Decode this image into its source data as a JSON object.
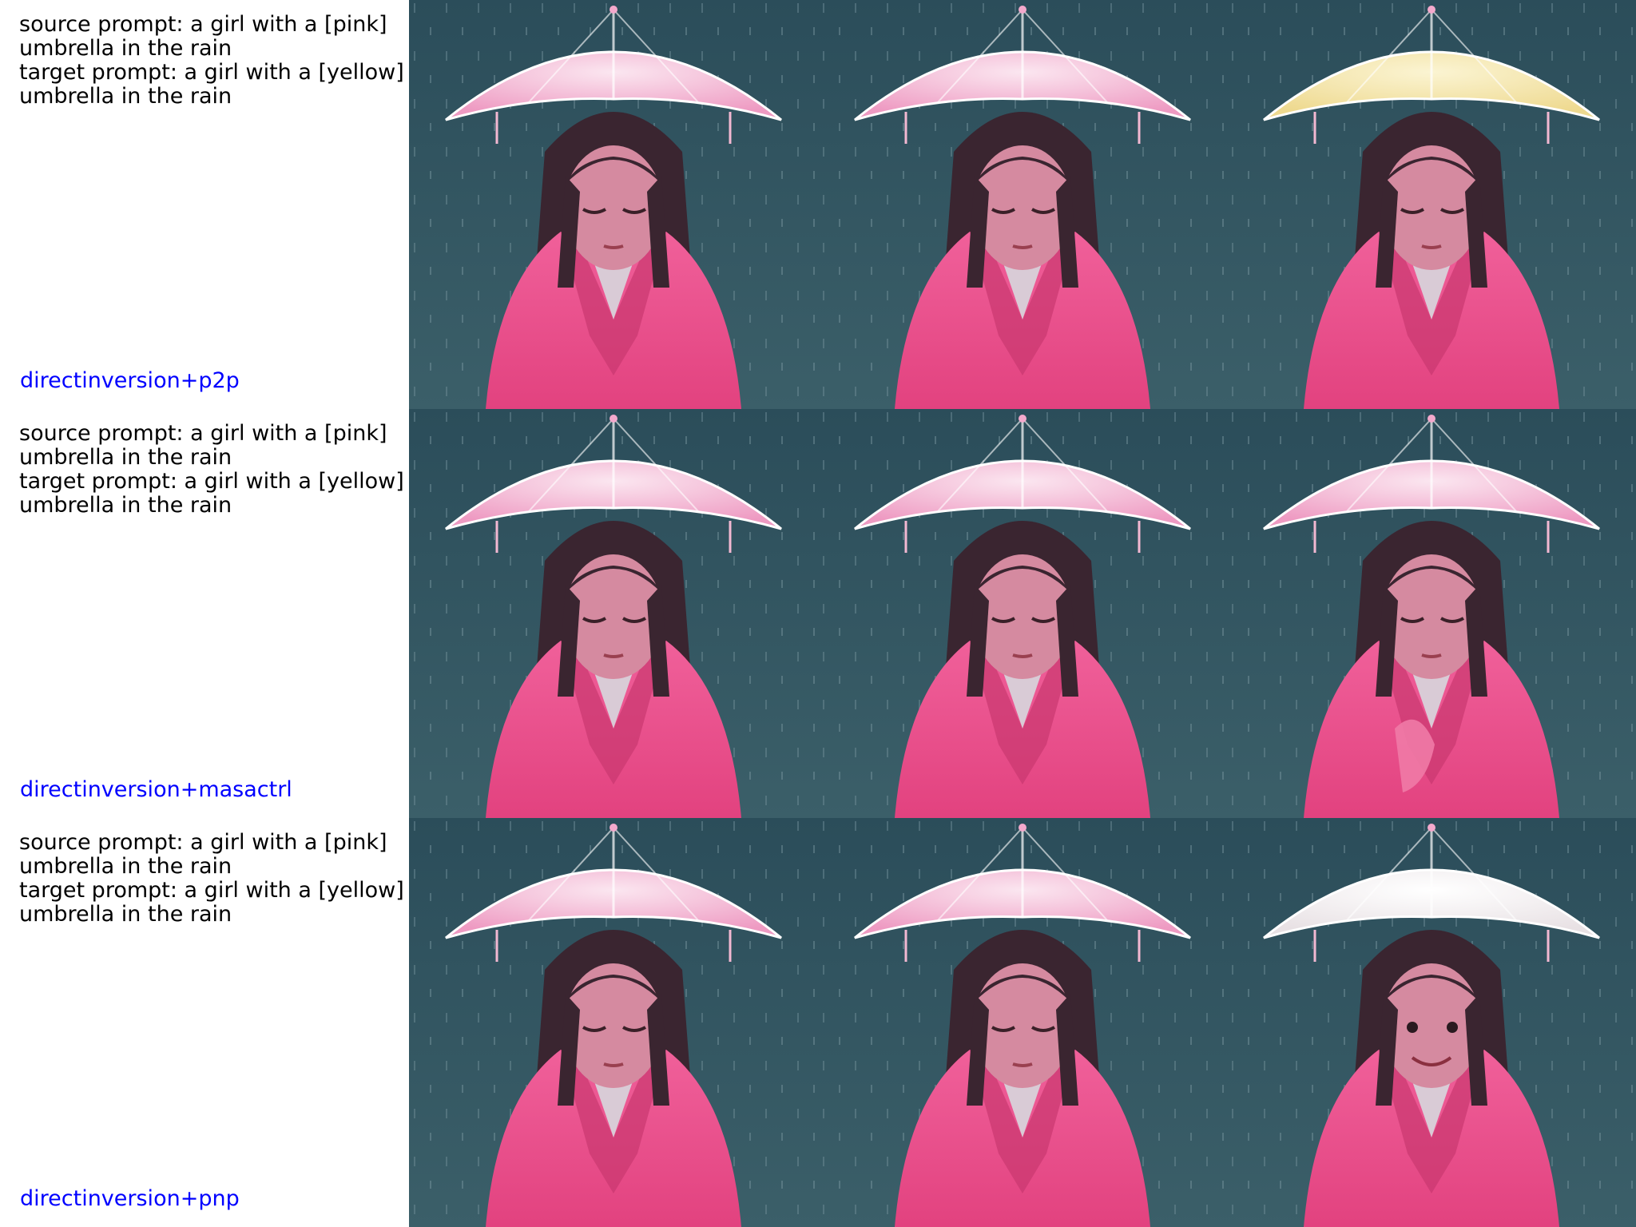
{
  "rows": [
    {
      "source_prompt_line1": "source prompt: a girl with a [pink]",
      "source_prompt_line2": "umbrella in the rain",
      "target_prompt_line1": "target prompt: a girl with a [yellow]",
      "target_prompt_line2": "umbrella in the rain",
      "method": "directinversion+p2p"
    },
    {
      "source_prompt_line1": "source prompt: a girl with a [pink]",
      "source_prompt_line2": "umbrella in the rain",
      "target_prompt_line1": "target prompt: a girl with a [yellow]",
      "target_prompt_line2": "umbrella in the rain",
      "method": "directinversion+masactrl"
    },
    {
      "source_prompt_line1": "source prompt: a girl with a [pink]",
      "source_prompt_line2": "umbrella in the rain",
      "target_prompt_line1": "target prompt: a girl with a [yellow]",
      "target_prompt_line2": "umbrella in the rain",
      "method": "directinversion+pnp"
    }
  ],
  "colors": {
    "background_rain": "#2f4f5c",
    "coat_pink": "#e8508a",
    "umbrella_pink": "#f3a9cc",
    "umbrella_yellow": "#f2e6a6",
    "umbrella_white": "#f4eef0",
    "hair": "#3a2530",
    "skin": "#d58aa0",
    "method_label": "#0000ff"
  },
  "tiles": [
    [
      "source-image",
      "reconstructed-image",
      "edited-image-yellow-umbrella"
    ],
    [
      "source-image",
      "reconstructed-image",
      "edited-image-pink-umbrella"
    ],
    [
      "source-image",
      "reconstructed-image",
      "edited-image-white-umbrella-smiling"
    ]
  ]
}
